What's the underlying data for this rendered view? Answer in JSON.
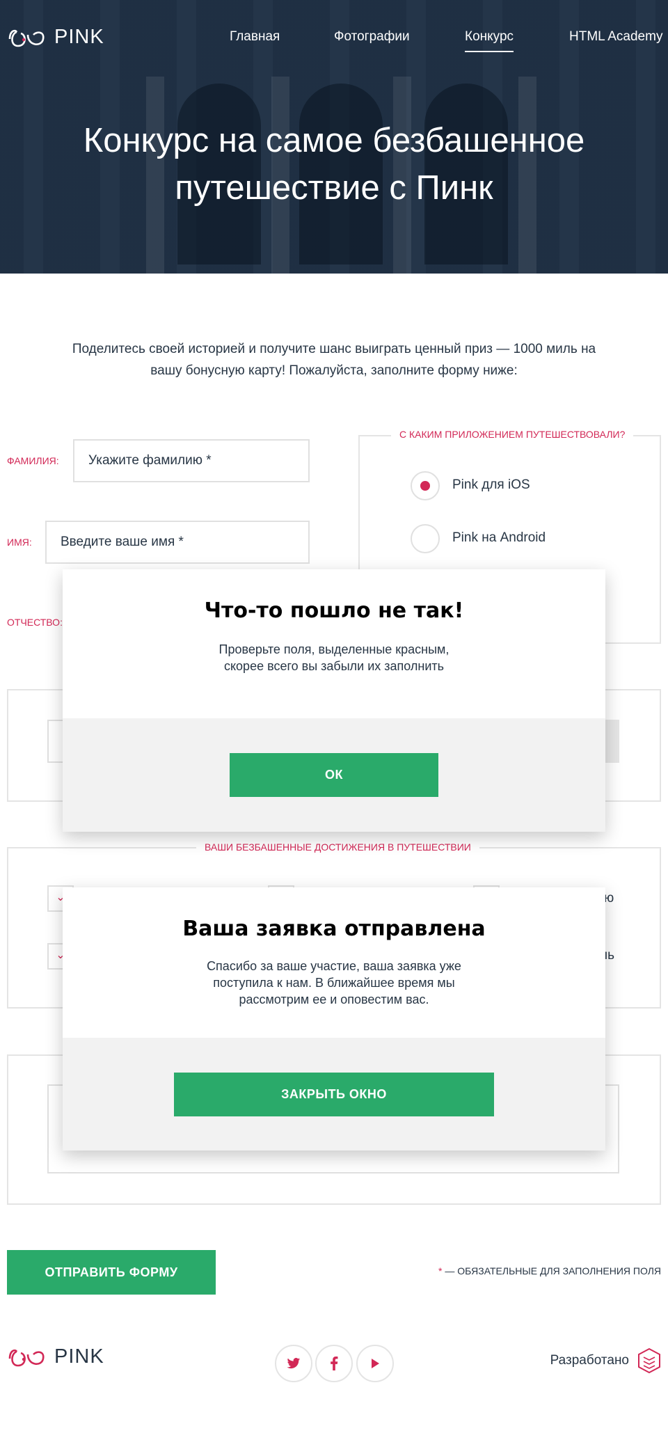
{
  "header": {
    "brand": "PINK",
    "nav": [
      "Главная",
      "Фотографии",
      "Конкурс",
      "HTML Academy"
    ],
    "active_nav": "Конкурс",
    "title_line1": "Конкурс на самое безбашенное",
    "title_line2": "путешествие с Пинк"
  },
  "intro": {
    "text": "Поделитесь своей историей и получите шанс выиграть ценный приз — 1000 миль на вашу бонусную карту! Пожалуйста, заполните форму ниже:"
  },
  "form": {
    "surname_label": "Фамилия:",
    "surname_placeholder": "Укажите фамилию *",
    "name_label": "Имя:",
    "name_placeholder": "Введите ваше имя *",
    "patronymic_label": "Отчество:",
    "app_legend": "С каким приложением путешествовали?",
    "app_options": [
      "Pink для iOS",
      "Pink на Android"
    ],
    "app_selected": "Pink для iOS",
    "achievements_legend": "Ваши безбашенные достижения в путешествии",
    "achievement_partial_1": "ю",
    "achievement_partial_2": "ль",
    "submit_label": "Отправить форму",
    "required_star": "*",
    "required_note": " — обязательные для заполнения поля"
  },
  "modal_error": {
    "title": "Что-то пошло не так!",
    "text_line1": "Проверьте поля, выделенные красным,",
    "text_line2": "скорее всего вы забыли их заполнить",
    "button": "ОК"
  },
  "modal_success": {
    "title": "Ваша заявка отправлена",
    "text_line1": "Спасибо за ваше участие, ваша заявка уже",
    "text_line2": "поступила к нам. В ближайшее время мы",
    "text_line3": "рассмотрим ее и оповестим вас.",
    "button": "Закрыть окно"
  },
  "footer": {
    "brand": "PINK",
    "social": [
      "twitter-icon",
      "facebook-icon",
      "youtube-icon"
    ],
    "developed_by": "Разработано"
  },
  "colors": {
    "accent": "#d22856",
    "button": "#2aaa6a",
    "text": "#283645",
    "border": "#e4e4e4"
  }
}
